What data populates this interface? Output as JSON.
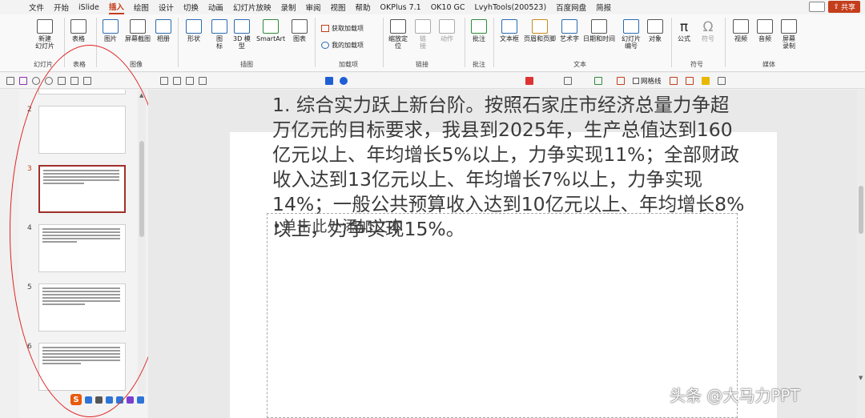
{
  "menu": {
    "items": [
      "文件",
      "开始",
      "iSlide",
      "插入",
      "绘图",
      "设计",
      "切换",
      "动画",
      "幻灯片放映",
      "录制",
      "审阅",
      "视图",
      "帮助",
      "OKPlus 7.1",
      "OK10 GC",
      "LvyhTools(200523)",
      "百度网盘",
      "简报"
    ],
    "active": "插入",
    "share_label": "共享"
  },
  "ribbon": {
    "buttons": {
      "new_slide": "新建\n幻灯片",
      "table": "表格",
      "picture": "图片",
      "screenshot": "屏幕截图",
      "album": "相册",
      "shapes": "形状",
      "icons": "图\n标",
      "model3d": "3D 模\n型",
      "smartart": "SmartArt",
      "chart": "图表",
      "get_addins": "获取加载项",
      "my_addins": "我的加载项",
      "zoom": "缩放定\n位",
      "link": "链\n接",
      "action": "动作",
      "comment": "批注",
      "textbox": "文本框",
      "header_footer": "页眉和页脚",
      "wordart": "艺术字",
      "datetime": "日期和时间",
      "slide_number": "幻灯片\n编号",
      "object": "对象",
      "equation": "公式",
      "symbol": "符号",
      "video": "视频",
      "audio": "音频",
      "screen_record": "屏幕\n录制"
    },
    "groups": {
      "slides": "幻灯片",
      "tables": "表格",
      "images": "图像",
      "illustrations": "插图",
      "addins": "加载项",
      "links": "链接",
      "comments": "批注",
      "text": "文本",
      "symbols": "符号",
      "media": "媒体"
    }
  },
  "qat": {
    "grid_checkbox": "网格线"
  },
  "slides_panel": {
    "numbers": [
      "2",
      "3",
      "4",
      "5",
      "6"
    ],
    "selected": "3"
  },
  "slide": {
    "body_text": "1. 综合实力跃上新台阶。按照石家庄市经济总量力争超万亿元的目标要求，我县到2025年，生产总值达到160亿元以上、年均增长5%以上，力争实现11%；全部财政收入达到13亿元以上、年均增长7%以上，力争实现14%；一般公共预算收入达到10亿元以上、年均增长8%以上，力争实现15%。",
    "placeholder": "•单击此处添加文本"
  },
  "watermark": "头条 @大马力PPT"
}
